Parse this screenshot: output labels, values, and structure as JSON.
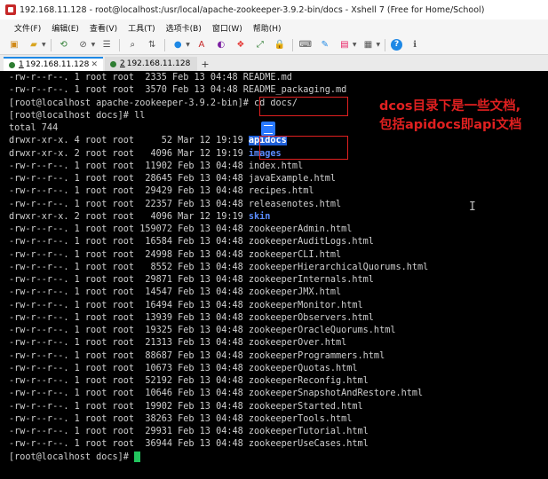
{
  "window": {
    "title": "192.168.11.128 - root@localhost:/usr/local/apache-zookeeper-3.9.2-bin/docs - Xshell 7 (Free for Home/School)"
  },
  "menu": [
    {
      "label": "文件(F)"
    },
    {
      "label": "编辑(E)"
    },
    {
      "label": "查看(V)"
    },
    {
      "label": "工具(T)"
    },
    {
      "label": "选项卡(B)"
    },
    {
      "label": "窗口(W)"
    },
    {
      "label": "帮助(H)"
    }
  ],
  "toolbar_icons": [
    "new-session-icon",
    "open-folder-icon",
    "reconnect-icon",
    "disconnect-icon",
    "properties-icon",
    "search-icon",
    "transfer-icon",
    "globe-icon",
    "font-icon",
    "color-scheme-icon",
    "xftp-icon",
    "fullscreen-icon",
    "lock-icon",
    "keyboard-icon",
    "compose-icon",
    "script-icon",
    "layout-icon",
    "help-icon",
    "info-icon"
  ],
  "tabs": [
    {
      "number": "1",
      "label": "192.168.11.128",
      "status_color": "#2e7d32",
      "active": true
    },
    {
      "number": "2",
      "label": "192.168.11.128",
      "status_color": "#2e7d32",
      "active": false
    }
  ],
  "terminal": {
    "colors": {
      "background": "#000000",
      "foreground": "#cfcfcf",
      "directory": "#5a8cff",
      "cursor": "#22c55e"
    },
    "lines": [
      {
        "text": "-rw-r--r--. 1 root root  2335 Feb 13 04:48 README.md"
      },
      {
        "text": "-rw-r--r--. 1 root root  3570 Feb 13 04:48 README_packaging.md"
      },
      {
        "text": "[root@localhost apache-zookeeper-3.9.2-bin]# cd docs/"
      },
      {
        "text": "[root@localhost docs]# ll"
      },
      {
        "text": "total 744"
      },
      {
        "text": "drwxr-xr-x. 4 root root     52 Mar 12 19:19 ",
        "name": "apidocs",
        "dir": true,
        "highlight": true
      },
      {
        "text": "drwxr-xr-x. 2 root root   4096 Mar 12 19:19 ",
        "name": "images",
        "dir": true
      },
      {
        "text": "-rw-r--r--. 1 root root  11902 Feb 13 04:48 index.html"
      },
      {
        "text": "-rw-r--r--. 1 root root  28645 Feb 13 04:48 javaExample.html"
      },
      {
        "text": "-rw-r--r--. 1 root root  29429 Feb 13 04:48 recipes.html"
      },
      {
        "text": "-rw-r--r--. 1 root root  22357 Feb 13 04:48 releasenotes.html"
      },
      {
        "text": "drwxr-xr-x. 2 root root   4096 Mar 12 19:19 ",
        "name": "skin",
        "dir": true
      },
      {
        "text": "-rw-r--r--. 1 root root 159072 Feb 13 04:48 zookeeperAdmin.html"
      },
      {
        "text": "-rw-r--r--. 1 root root  16584 Feb 13 04:48 zookeeperAuditLogs.html"
      },
      {
        "text": "-rw-r--r--. 1 root root  24998 Feb 13 04:48 zookeeperCLI.html"
      },
      {
        "text": "-rw-r--r--. 1 root root   8552 Feb 13 04:48 zookeeperHierarchicalQuorums.html"
      },
      {
        "text": "-rw-r--r--. 1 root root  29871 Feb 13 04:48 zookeeperInternals.html"
      },
      {
        "text": "-rw-r--r--. 1 root root  14547 Feb 13 04:48 zookeeperJMX.html"
      },
      {
        "text": "-rw-r--r--. 1 root root  16494 Feb 13 04:48 zookeeperMonitor.html"
      },
      {
        "text": "-rw-r--r--. 1 root root  13939 Feb 13 04:48 zookeeperObservers.html"
      },
      {
        "text": "-rw-r--r--. 1 root root  19325 Feb 13 04:48 zookeeperOracleQuorums.html"
      },
      {
        "text": "-rw-r--r--. 1 root root  21313 Feb 13 04:48 zookeeperOver.html"
      },
      {
        "text": "-rw-r--r--. 1 root root  88687 Feb 13 04:48 zookeeperProgrammers.html"
      },
      {
        "text": "-rw-r--r--. 1 root root  10673 Feb 13 04:48 zookeeperQuotas.html"
      },
      {
        "text": "-rw-r--r--. 1 root root  52192 Feb 13 04:48 zookeeperReconfig.html"
      },
      {
        "text": "-rw-r--r--. 1 root root  10646 Feb 13 04:48 zookeeperSnapshotAndRestore.html"
      },
      {
        "text": "-rw-r--r--. 1 root root  19902 Feb 13 04:48 zookeeperStarted.html"
      },
      {
        "text": "-rw-r--r--. 1 root root  38263 Feb 13 04:48 zookeeperTools.html"
      },
      {
        "text": "-rw-r--r--. 1 root root  29931 Feb 13 04:48 zookeeperTutorial.html"
      },
      {
        "text": "-rw-r--r--. 1 root root  36944 Feb 13 04:48 zookeeperUseCases.html"
      },
      {
        "text": "[root@localhost docs]# ",
        "cursor": true
      }
    ]
  },
  "annotation": {
    "color": "#e02020",
    "lines": [
      "dcos目录下是一些文档,",
      "包括apidocs即api文档"
    ]
  }
}
